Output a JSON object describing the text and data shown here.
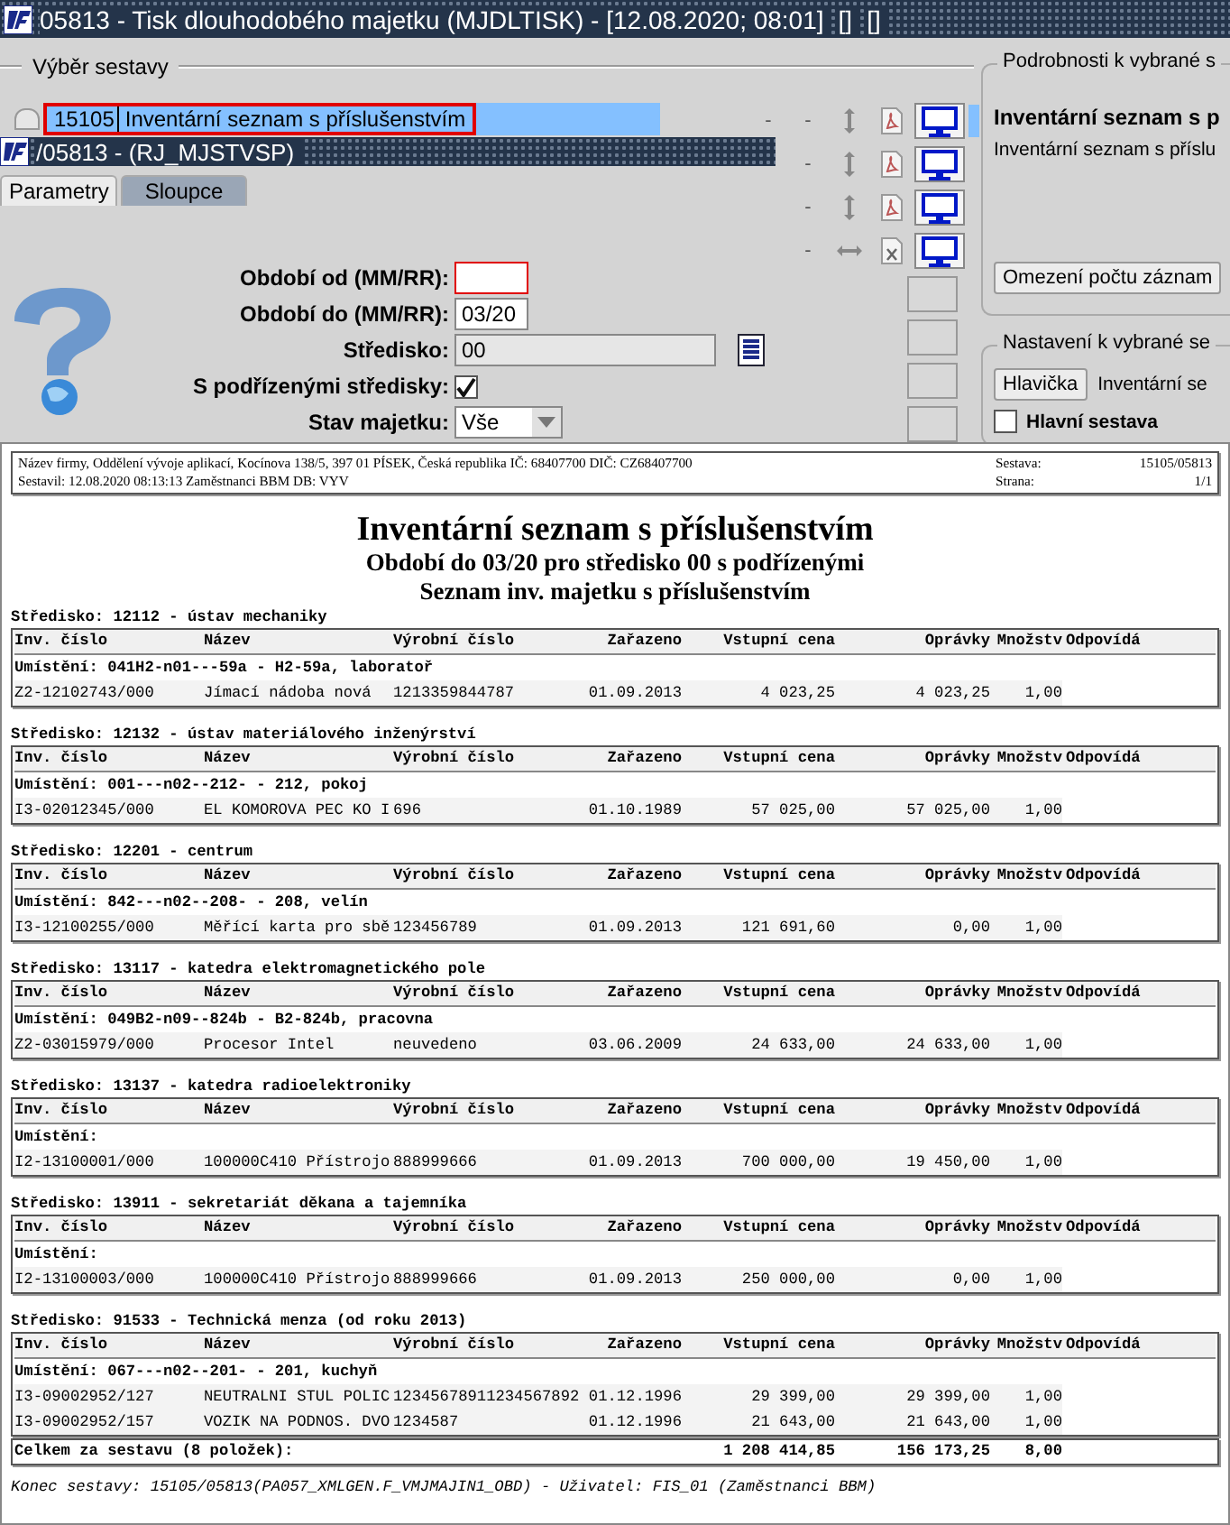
{
  "window": {
    "title": "05813 - Tisk dlouhodobého majetku (MJDLTISK) - [12.08.2020; 08:01]",
    "indicators": [
      "[]",
      "[]"
    ]
  },
  "report_picker": {
    "legend": "Výběr sestavy",
    "reports": [
      {
        "code": "15105",
        "name": "Inventární seznam s příslušenstvím",
        "selected": true
      }
    ],
    "actions": [
      {
        "kind": "pdf",
        "dashes": [
          "-",
          "-"
        ]
      },
      {
        "kind": "pdf",
        "dashes": [
          "-"
        ]
      },
      {
        "kind": "pdf",
        "dashes": [
          "-"
        ]
      },
      {
        "kind": "excel",
        "dashes": [
          "-"
        ]
      }
    ]
  },
  "sub_window": {
    "title": "/05813 - (RJ_MJSTVSP)"
  },
  "tabs": [
    {
      "label": "Parametry",
      "selected": true
    },
    {
      "label": "Sloupce",
      "selected": false
    }
  ],
  "parameters": [
    {
      "kind": "text",
      "label": "Období od (MM/RR):",
      "focused": true
    },
    {
      "kind": "text",
      "label": "Období do (MM/RR):",
      "value": "03/20",
      "focused": false
    },
    {
      "kind": "lookup",
      "label": "Středisko:",
      "value": "00"
    },
    {
      "kind": "checkbox",
      "label": "S podřízenými středisky:",
      "checked": true
    },
    {
      "kind": "select",
      "label": "Stav majetku:",
      "value": "Vše"
    }
  ],
  "details": {
    "legend": "Podrobnosti k vybrané s",
    "heading": "Inventární seznam s p",
    "description": "Inventární seznam s příslu",
    "button": "Omezení počtu záznam"
  },
  "settings": {
    "legend": "Nastavení k vybrané se",
    "button": "Hlavička",
    "caption": "Inventární se",
    "checkbox": {
      "label": "Hlavní sestava",
      "checked": false
    }
  },
  "report": {
    "header_lines": [
      "Název firmy, Oddělení vývoje aplikací, Kocínova 138/5, 397 01 PÍSEK, Česká republika  IČ: 68407700  DIČ: CZ68407700",
      "Sestavil: 12.08.2020 08:13:13 Zaměstnanci BBM  DB: VYV"
    ],
    "meta": [
      {
        "label": "Sestava:",
        "value": "15105/05813"
      },
      {
        "label": "Strana:",
        "value": "1/1"
      }
    ],
    "title": "Inventární seznam s příslušenstvím",
    "subtitles": [
      "Období do 03/20 pro středisko 00 s podřízenými",
      "Seznam inv. majetku s příslušenstvím"
    ],
    "sections": [
      {
        "heading": "Středisko: 12112 - ústav mechaniky",
        "columns": [
          "Inv. číslo",
          "Název",
          "Výrobní číslo",
          "Zařazeno",
          "Vstupní cena",
          "Oprávky",
          "Množstv",
          "Odpovídá"
        ],
        "location": "Umístění: 041H2-n01---59a - H2-59a, laboratoř",
        "rows": [
          [
            "Z2-12102743/000",
            "Jímací nádoba nová",
            "1213359844787",
            "01.09.2013",
            "4 023,25",
            "4 023,25",
            "1,00"
          ]
        ]
      },
      {
        "heading": "Středisko: 12132 - ústav materiálového inženýrství",
        "columns": [
          "Inv. číslo",
          "Název",
          "Výrobní číslo",
          "Zařazeno",
          "Vstupní cena",
          "Oprávky",
          "Množstv",
          "Odpovídá"
        ],
        "location": "Umístění: 001---n02--212- - 212, pokoj",
        "rows": [
          [
            "I3-02012345/000",
            "EL KOMOROVA PEC KO I",
            "696",
            "01.10.1989",
            "57 025,00",
            "57 025,00",
            "1,00"
          ]
        ]
      },
      {
        "heading": "Středisko: 12201 - centrum",
        "columns": [
          "Inv. číslo",
          "Název",
          "Výrobní číslo",
          "Zařazeno",
          "Vstupní cena",
          "Oprávky",
          "Množstv",
          "Odpovídá"
        ],
        "location": "Umístění: 842---n02--208- - 208, velín",
        "rows": [
          [
            "I3-12100255/000",
            "Měřící karta pro sbě",
            "123456789",
            "01.09.2013",
            "121 691,60",
            "0,00",
            "1,00"
          ]
        ]
      },
      {
        "heading": "Středisko: 13117 - katedra elektromagnetického pole",
        "columns": [
          "Inv. číslo",
          "Název",
          "Výrobní číslo",
          "Zařazeno",
          "Vstupní cena",
          "Oprávky",
          "Množstv",
          "Odpovídá"
        ],
        "location": "Umístění: 049B2-n09--824b - B2-824b, pracovna",
        "rows": [
          [
            "Z2-03015979/000",
            "Procesor Intel",
            "neuvedeno",
            "03.06.2009",
            "24 633,00",
            "24 633,00",
            "1,00"
          ]
        ]
      },
      {
        "heading": "Středisko: 13137 - katedra radioelektroniky",
        "columns": [
          "Inv. číslo",
          "Název",
          "Výrobní číslo",
          "Zařazeno",
          "Vstupní cena",
          "Oprávky",
          "Množstv",
          "Odpovídá"
        ],
        "location": "Umístění:",
        "rows": [
          [
            "I2-13100001/000",
            "100000C410 Přístrojo",
            "888999666",
            "01.09.2013",
            "700 000,00",
            "19 450,00",
            "1,00"
          ]
        ]
      },
      {
        "heading": "Středisko: 13911 - sekretariát děkana a tajemníka",
        "columns": [
          "Inv. číslo",
          "Název",
          "Výrobní číslo",
          "Zařazeno",
          "Vstupní cena",
          "Oprávky",
          "Množstv",
          "Odpovídá"
        ],
        "location": "Umístění:",
        "rows": [
          [
            "I2-13100003/000",
            "100000C410 Přístrojo",
            "888999666",
            "01.09.2013",
            "250 000,00",
            "0,00",
            "1,00"
          ]
        ]
      },
      {
        "heading": "Středisko: 91533 - Technická menza (od roku 2013)",
        "columns": [
          "Inv. číslo",
          "Název",
          "Výrobní číslo",
          "Zařazeno",
          "Vstupní cena",
          "Oprávky",
          "Množstv",
          "Odpovídá"
        ],
        "location": "Umístění: 067---n02--201- - 201, kuchyň",
        "rows": [
          [
            "I3-09002952/127",
            "NEUTRALNI STUL POLIC",
            "12345678911234567892",
            "01.12.1996",
            "29 399,00",
            "29 399,00",
            "1,00"
          ],
          [
            "I3-09002952/157",
            "VOZIK NA PODNOS. DVO",
            "1234587",
            "01.12.1996",
            "21 643,00",
            "21 643,00",
            "1,00"
          ]
        ]
      }
    ],
    "totals": {
      "label": "Celkem za sestavu (8 položek):",
      "values": [
        "1 208 414,85",
        "156 173,25",
        "8,00"
      ]
    },
    "footer": "Konec sestavy: 15105/05813(PA057_XMLGEN.F_VMJMAJIN1_OBD) - Uživatel: FIS_01 (Zaměstnanci BBM)"
  }
}
